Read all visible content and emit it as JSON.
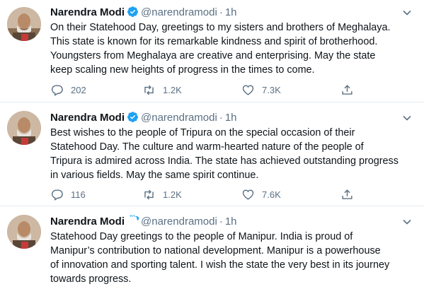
{
  "tweets": [
    {
      "name": "Narendra Modi",
      "handle": "@narendramodi",
      "separator": "·",
      "time": "1h",
      "text": "On their Statehood Day, greetings to my sisters and brothers of Meghalaya.\nThis state is known for its remarkable kindness and spirit of brotherhood.\nYoungsters from Meghalaya are creative and enterprising. May the state\nkeep scaling new heights of progress in the times to come.",
      "replies": "202",
      "retweets": "1.2K",
      "likes": "7.3K"
    },
    {
      "name": "Narendra Modi",
      "handle": "@narendramodi",
      "separator": "·",
      "time": "1h",
      "text": "Best wishes to the people of Tripura on the special occasion of their\nStatehood Day. The culture and warm-hearted nature of the people of\nTripura is admired across India. The state has achieved outstanding progress\nin various fields. May the same spirit continue.",
      "replies": "116",
      "retweets": "1.2K",
      "likes": "7.6K"
    },
    {
      "name": "Narendra Modi",
      "handle": "@narendramodi",
      "separator": "·",
      "time": "1h",
      "text": "Statehood Day greetings to the people of Manipur. India is proud of\nManipur’s contribution to national development. Manipur is a powerhouse\nof innovation and sporting talent. I wish the state the very best in its journey\ntowards progress."
    }
  ],
  "colors": {
    "verified": "#1da1f2",
    "secondary_text": "#5b7083",
    "divider": "#e6ecf0"
  },
  "icons": [
    "avatar",
    "verified-badge-icon",
    "chevron-down-icon",
    "reply-icon",
    "retweet-icon",
    "like-icon",
    "share-icon"
  ]
}
